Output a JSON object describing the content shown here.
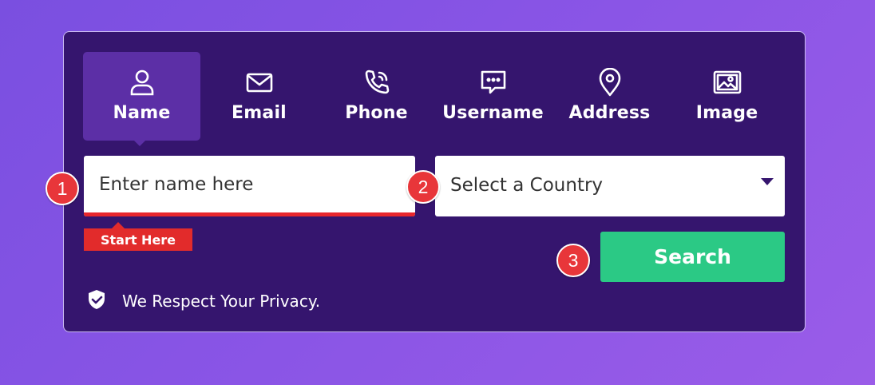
{
  "tabs": [
    {
      "label": "Name",
      "icon": "person-icon",
      "active": true
    },
    {
      "label": "Email",
      "icon": "envelope-icon",
      "active": false
    },
    {
      "label": "Phone",
      "icon": "phone-icon",
      "active": false
    },
    {
      "label": "Username",
      "icon": "chat-bubble-icon",
      "active": false
    },
    {
      "label": "Address",
      "icon": "location-pin-icon",
      "active": false
    },
    {
      "label": "Image",
      "icon": "image-icon",
      "active": false
    }
  ],
  "name_input": {
    "placeholder": "Enter name here",
    "value": "",
    "hint": "Start Here"
  },
  "country_select": {
    "selected": "Select a Country"
  },
  "search_button": {
    "label": "Search"
  },
  "privacy": {
    "text": "We Respect Your Privacy.",
    "icon": "shield-check-icon"
  },
  "badges": [
    "1",
    "2",
    "3"
  ],
  "colors": {
    "background": "#8552e4",
    "panel": "#35156e",
    "active_tab": "#5c2fa6",
    "accent_red": "#e22b2b",
    "search_green": "#2bc985",
    "badge_red": "#e8363a"
  }
}
